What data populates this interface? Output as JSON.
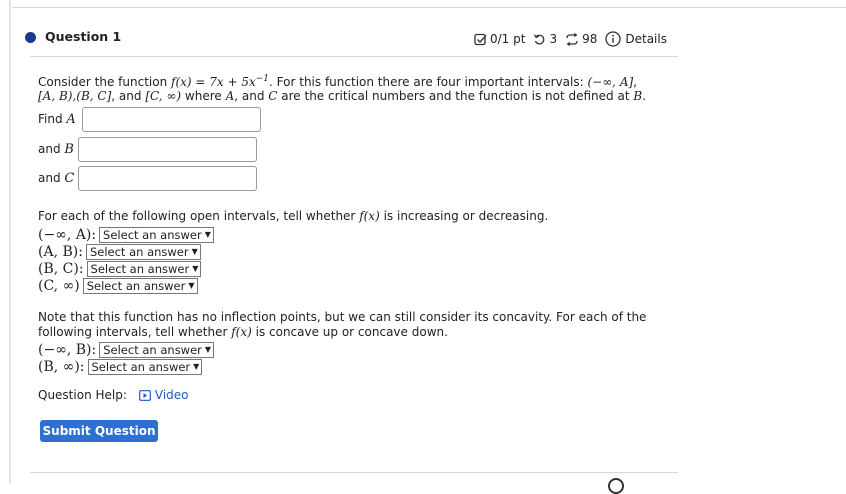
{
  "question": {
    "title": "Question 1",
    "score": "0/1 pt",
    "retries": "3",
    "attempts": "98",
    "details": "Details"
  },
  "intro": {
    "l1a": "Consider the function ",
    "fx": "f(x) = 7x + 5x",
    "exp": "−1",
    "l1b": ". For this function there are four important intervals: ",
    "int1": "(−∞, A]",
    "comma": ",",
    "int2": "[A, B),(B, C]",
    "l2a": ", and ",
    "int3": "[C, ∞)",
    "l2b": " where ",
    "varA": "A",
    "l2c": ", and ",
    "varC": "C",
    "l2d": " are the critical numbers and the function is not defined at ",
    "varB": "B",
    "period": "."
  },
  "fields": [
    {
      "prefix": "Find ",
      "var": "A",
      "value": ""
    },
    {
      "prefix": "and ",
      "var": "B",
      "value": ""
    },
    {
      "prefix": "and ",
      "var": "C",
      "value": ""
    }
  ],
  "increasing": {
    "pre": "For each of the following open intervals, tell whether ",
    "fx": "f(x)",
    "post": " is increasing or decreasing.",
    "rows": [
      "(−∞, A):",
      "(A, B):",
      "(B, C):",
      "(C, ∞)"
    ]
  },
  "concavity": {
    "line1": "Note that this function has no inflection points, but we can still consider its concavity. For each of the",
    "line2a": "following intervals, tell whether ",
    "fx": "f(x)",
    "line2b": " is concave up or concave down.",
    "rows": [
      "(−∞, B):",
      "(B, ∞):"
    ]
  },
  "select_placeholder": "Select an answer",
  "help": {
    "label": "Question Help:",
    "video": "Video"
  },
  "submit_label": "Submit Question",
  "colors": {
    "accent": "#2f6fd1",
    "link": "#1e58c4",
    "bullet": "#1a3a8f"
  }
}
